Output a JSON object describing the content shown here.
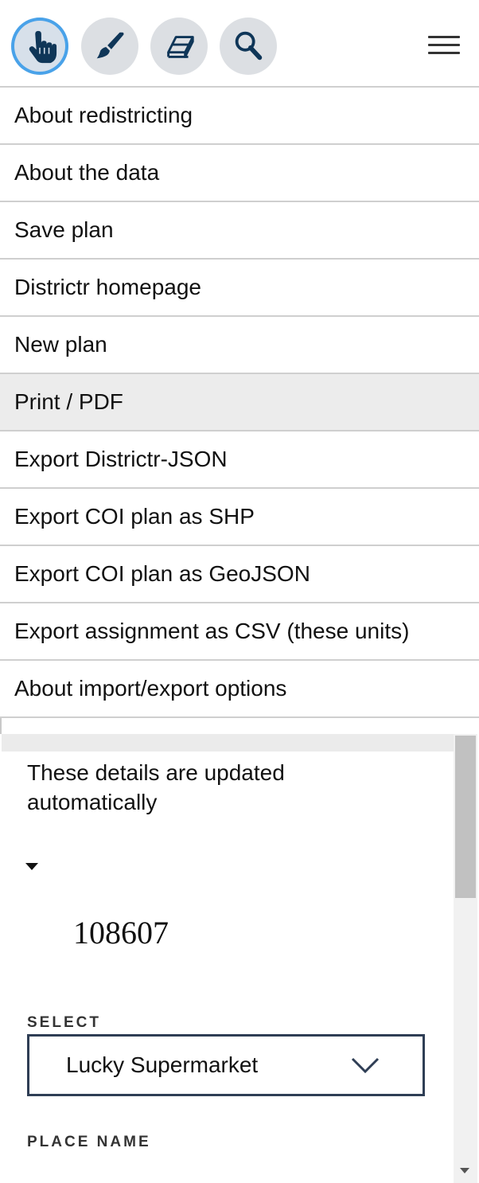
{
  "toolbar": {
    "tools": [
      {
        "name": "pan",
        "icon": "hand-pointer-icon",
        "active": true
      },
      {
        "name": "brush",
        "icon": "paintbrush-icon",
        "active": false
      },
      {
        "name": "eraser",
        "icon": "eraser-icon",
        "active": false
      },
      {
        "name": "inspect",
        "icon": "magnifier-icon",
        "active": false
      }
    ],
    "menu_icon": "hamburger-menu-icon"
  },
  "menu": {
    "items": [
      "About redistricting",
      "About the data",
      "Save plan",
      "Districtr homepage",
      "New plan",
      "Print / PDF",
      "Export Districtr-JSON",
      "Export COI plan as SHP",
      "Export COI plan as GeoJSON",
      "Export assignment as CSV (these units)",
      "About import/export options"
    ],
    "hovered_index": 5
  },
  "details": {
    "auto_update_text": "These details are updated automatically",
    "number": "108607",
    "select_label": "SELECT",
    "select_value": "Lucky Supermarket",
    "place_name_label": "PLACE NAME"
  },
  "colors": {
    "active_ring": "#49a2e9",
    "icon_dark": "#0f3658",
    "select_border": "#2f3e55"
  }
}
